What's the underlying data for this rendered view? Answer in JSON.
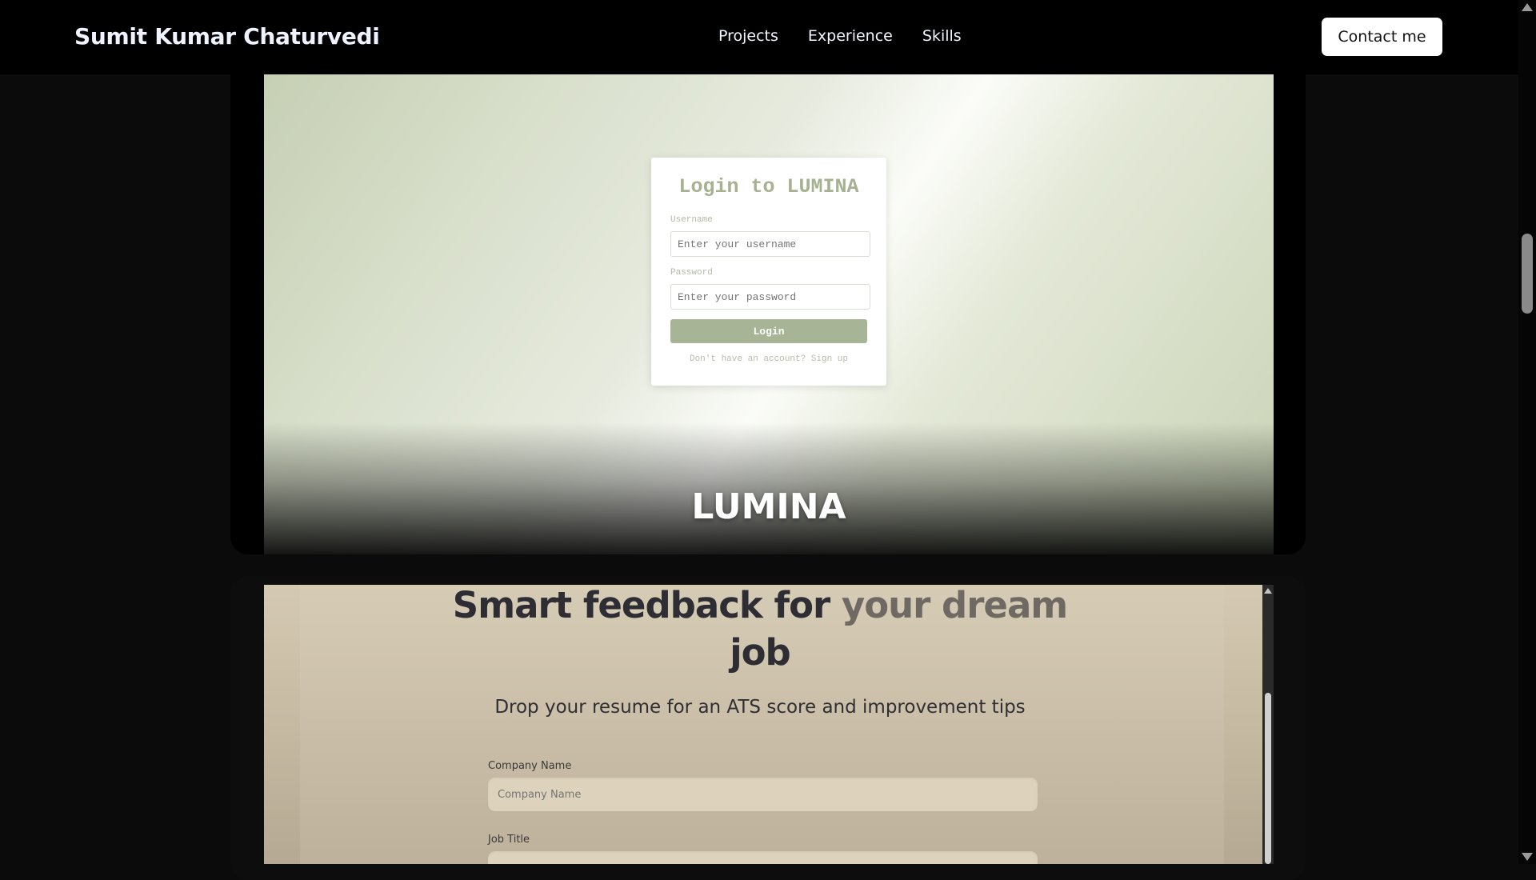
{
  "header": {
    "brand": "Sumit Kumar Chaturvedi",
    "nav": [
      "Projects",
      "Experience",
      "Skills"
    ],
    "contact_label": "Contact me"
  },
  "project_lumina": {
    "title": "LUMINA",
    "login": {
      "heading": "Login to LUMINA",
      "username_label": "Username",
      "username_placeholder": "Enter your username",
      "password_label": "Password",
      "password_placeholder": "Enter your password",
      "button_label": "Login",
      "signup_text": "Don't have an account? Sign up"
    }
  },
  "project_resume": {
    "hero_dark": "Smart feedback for",
    "hero_accent": "your dream",
    "hero_end": "job",
    "subtitle": "Drop your resume for an ATS score and improvement tips",
    "company_label": "Company Name",
    "company_placeholder": "Company Name",
    "job_label": "Job Title"
  },
  "colors": {
    "nav_bg": "#000000",
    "login_button": "#a7b496",
    "resume_bg": "#c7bba4"
  }
}
